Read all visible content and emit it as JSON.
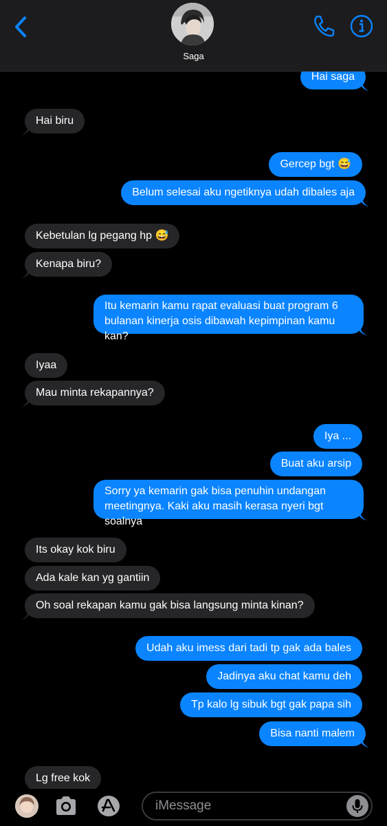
{
  "header": {
    "contact_name": "Saga",
    "accent_color": "#0a84ff",
    "back_icon": "chevron-left-icon",
    "call_icon": "phone-icon",
    "info_icon": "info-icon"
  },
  "messages": [
    {
      "from": "me",
      "text": "Hai saga"
    },
    {
      "from": "them",
      "text": "Hai biru"
    },
    {
      "from": "me",
      "text": "Gercep bgt 😅"
    },
    {
      "from": "me",
      "text": "Belum selesai aku ngetiknya udah dibales aja"
    },
    {
      "from": "them",
      "text": "Kebetulan lg pegang hp 😅"
    },
    {
      "from": "them",
      "text": "Kenapa biru?"
    },
    {
      "from": "me",
      "text": "Itu kemarin kamu rapat evaluasi buat program 6 bulanan kinerja osis dibawah kepimpinan kamu kan?"
    },
    {
      "from": "them",
      "text": "Iyaa"
    },
    {
      "from": "them",
      "text": "Mau minta rekapannya?"
    },
    {
      "from": "me",
      "text": "Iya ..."
    },
    {
      "from": "me",
      "text": "Buat aku arsip"
    },
    {
      "from": "me",
      "text": "Sorry ya kemarin gak bisa penuhin undangan meetingnya. Kaki aku masih kerasa nyeri bgt soalnya"
    },
    {
      "from": "them",
      "text": "Its okay kok biru"
    },
    {
      "from": "them",
      "text": "Ada kale kan yg gantiin"
    },
    {
      "from": "them",
      "text": "Oh soal rekapan kamu gak bisa langsung minta kinan?"
    },
    {
      "from": "me",
      "text": "Udah aku imess dari tadi tp gak ada bales"
    },
    {
      "from": "me",
      "text": "Jadinya aku chat kamu deh"
    },
    {
      "from": "me",
      "text": "Tp kalo lg sibuk bgt gak papa sih"
    },
    {
      "from": "me",
      "text": "Bisa nanti malem"
    },
    {
      "from": "them",
      "text": "Lg free kok"
    }
  ],
  "composer": {
    "placeholder": "iMessage",
    "camera_icon": "camera-icon",
    "appstore_icon": "app-store-icon",
    "mic_icon": "microphone-icon"
  }
}
